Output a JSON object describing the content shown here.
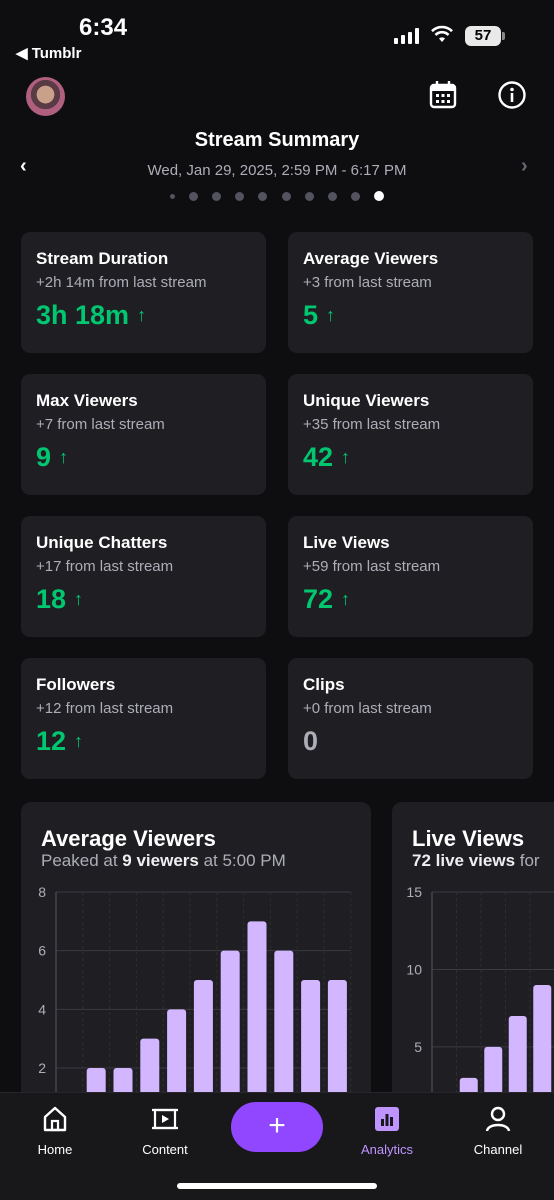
{
  "status_bar": {
    "time": "6:34",
    "back_app": "◀ Tumblr",
    "battery": "57"
  },
  "header": {
    "title": "Stream Summary",
    "subtitle": "Wed, Jan 29, 2025, 2:59 PM - 6:17 PM",
    "page_dots": 10,
    "active_dot": 9
  },
  "stats": [
    {
      "title": "Stream Duration",
      "sub": "+2h 14m from last stream",
      "value": "3h 18m",
      "trend": "up"
    },
    {
      "title": "Average Viewers",
      "sub": "+3 from last stream",
      "value": "5",
      "trend": "up"
    },
    {
      "title": "Max Viewers",
      "sub": "+7 from last stream",
      "value": "9",
      "trend": "up"
    },
    {
      "title": "Unique Viewers",
      "sub": "+35 from last stream",
      "value": "42",
      "trend": "up"
    },
    {
      "title": "Unique Chatters",
      "sub": "+17 from last stream",
      "value": "18",
      "trend": "up"
    },
    {
      "title": "Live Views",
      "sub": "+59 from last stream",
      "value": "72",
      "trend": "up"
    },
    {
      "title": "Followers",
      "sub": "+12 from last stream",
      "value": "12",
      "trend": "up"
    },
    {
      "title": "Clips",
      "sub": "+0 from last stream",
      "value": "0",
      "trend": "none"
    }
  ],
  "charts_text": {
    "avg": {
      "title": "Average Viewers",
      "sub_pre": "Peaked at ",
      "sub_bold": "9 viewers",
      "sub_post": " at 5:00 PM"
    },
    "live": {
      "title": "Live Views",
      "sub_bold": "72 live views",
      "sub_post": " for"
    }
  },
  "chart_data": [
    {
      "type": "bar",
      "title": "Average Viewers",
      "yticks": [
        2,
        4,
        6,
        8
      ],
      "ylim": [
        0.5,
        8
      ],
      "values": [
        1,
        2,
        2,
        3,
        4,
        5,
        6,
        7,
        6,
        5,
        5
      ],
      "color": "#d2b6ff"
    },
    {
      "type": "bar",
      "title": "Live Views",
      "yticks": [
        5,
        10,
        15
      ],
      "ylim": [
        0.8,
        15
      ],
      "values": [
        1,
        3,
        5,
        7,
        9
      ],
      "color": "#d2b6ff"
    }
  ],
  "nav": {
    "home": "Home",
    "content": "Content",
    "add": "+",
    "analytics": "Analytics",
    "channel": "Channel"
  },
  "colors": {
    "accent": "#9147ff",
    "positive": "#00c770",
    "bar": "#d2b6ff",
    "card": "#1f1f23"
  }
}
